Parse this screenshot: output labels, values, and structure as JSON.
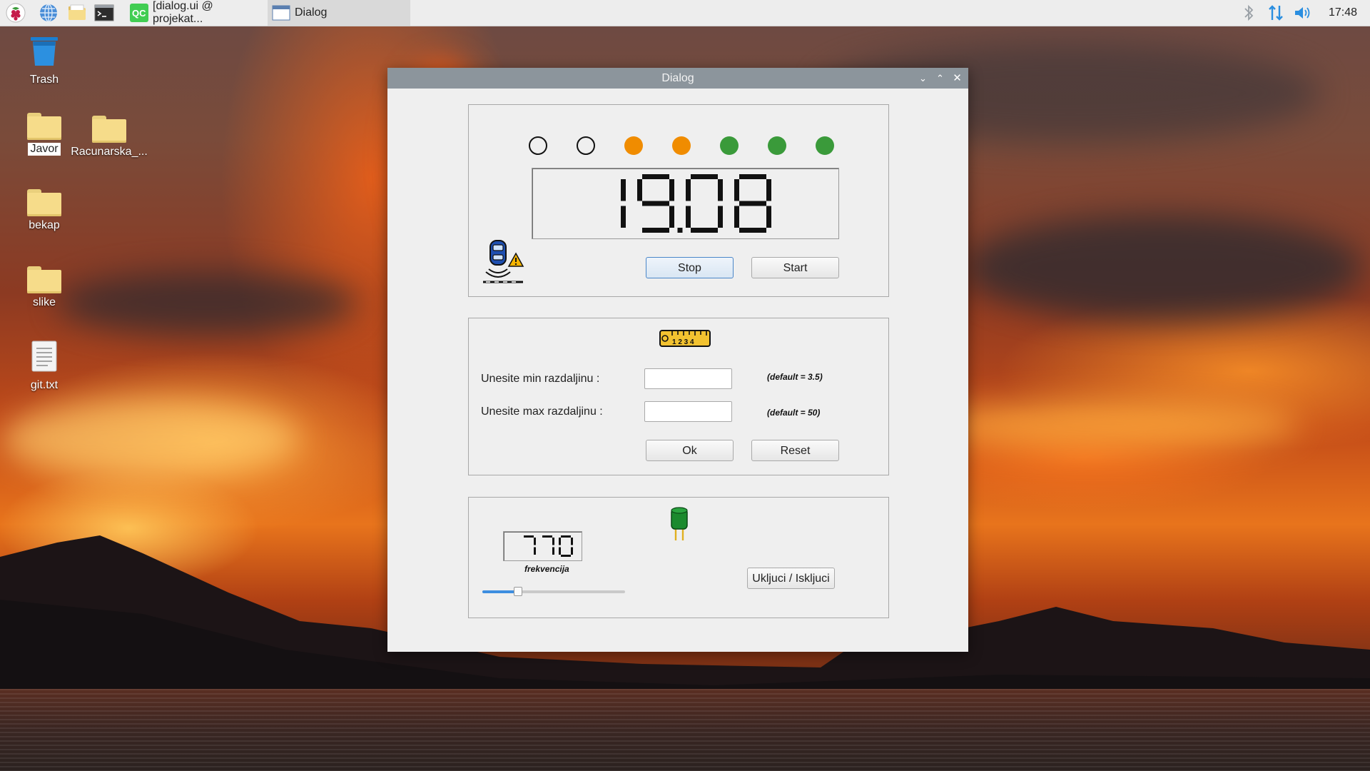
{
  "taskbar": {
    "tasks": [
      {
        "label": "[dialog.ui @ projekat..."
      },
      {
        "label": "Dialog"
      }
    ],
    "clock": "17:48"
  },
  "desktop": {
    "icons": [
      {
        "label": "Trash"
      },
      {
        "label": "Javor"
      },
      {
        "label": "Racunarska_..."
      },
      {
        "label": "bekap"
      },
      {
        "label": "slike"
      },
      {
        "label": "git.txt"
      }
    ]
  },
  "dialog": {
    "title": "Dialog",
    "leds": [
      {
        "color": "none"
      },
      {
        "color": "none"
      },
      {
        "color": "#f08c00"
      },
      {
        "color": "#f08c00"
      },
      {
        "color": "#3a9a3a"
      },
      {
        "color": "#3a9a3a"
      },
      {
        "color": "#3a9a3a"
      }
    ],
    "distance_display": "19.08",
    "stop_label": "Stop",
    "start_label": "Start",
    "min_label": "Unesite min razdaljinu :",
    "max_label": "Unesite max razdaljinu :",
    "min_value": "",
    "max_value": "",
    "min_note": "(default = 3.5)",
    "max_note": "(default = 50)",
    "ok_label": "Ok",
    "reset_label": "Reset",
    "frequency_display": "770",
    "frequency_label": "frekvencija",
    "slider_level": 0.25,
    "toggle_label": "Ukljuci / Iskljuci"
  },
  "colors": {
    "titlebar": "#8c959c",
    "accent": "#4a86c8",
    "led_orange": "#f08c00",
    "led_green": "#3a9a3a"
  }
}
